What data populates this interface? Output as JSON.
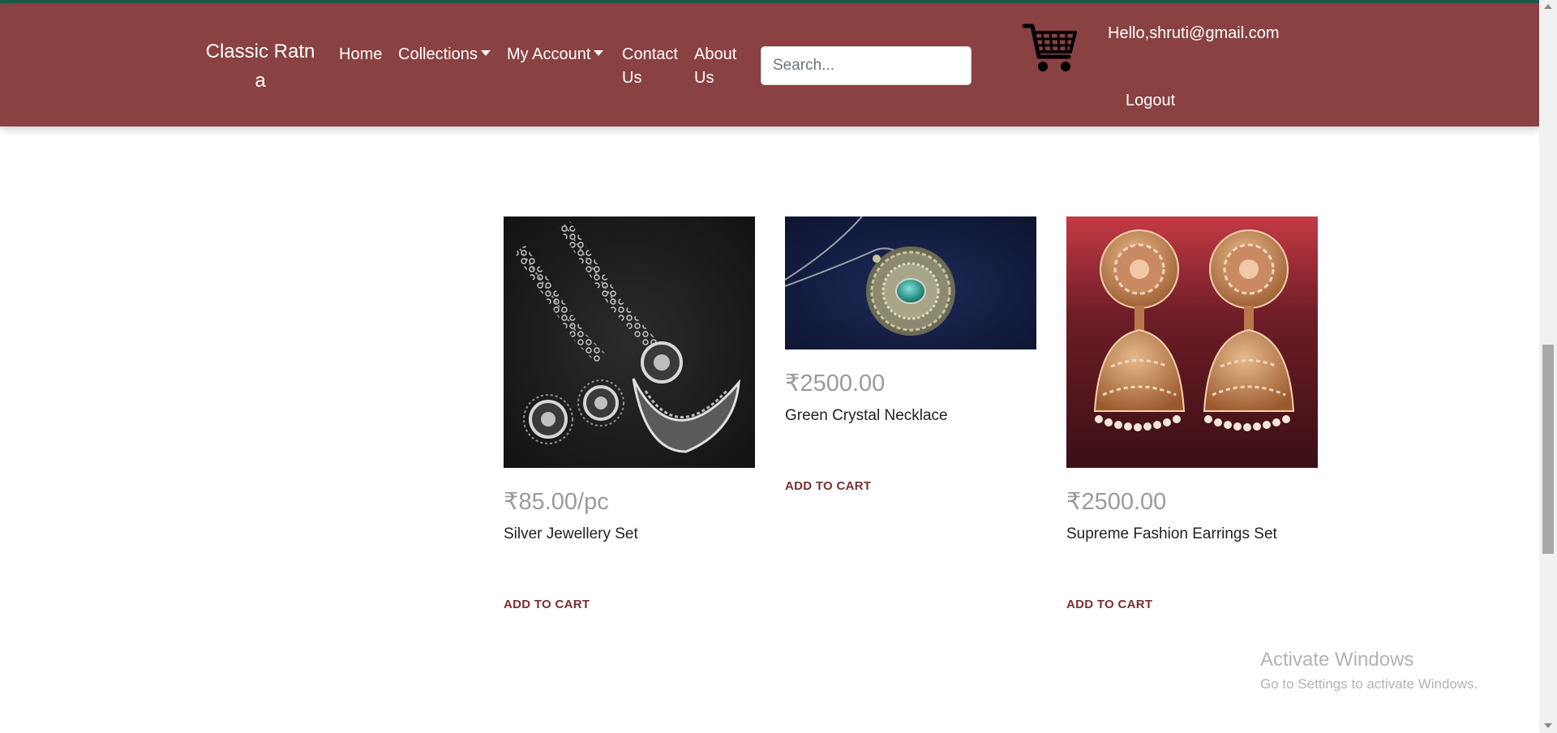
{
  "header": {
    "brand": "Classic Ratn a",
    "nav": {
      "home": "Home",
      "collections": "Collections",
      "my_account": "My Account",
      "contact_line1": "Contact",
      "contact_line2": "Us",
      "about_line1": "About",
      "about_line2": "Us"
    },
    "search_placeholder": "Search...",
    "cart_icon": "shopping-cart-icon",
    "greeting": "Hello,shruti@gmail.com",
    "logout": "Logout"
  },
  "products": [
    {
      "price": "₹85.00/pc",
      "name": "Silver Jewellery Set",
      "add_to_cart": "ADD TO CART"
    },
    {
      "price": "₹2500.00",
      "name": "Green Crystal Necklace",
      "add_to_cart": "ADD TO CART"
    },
    {
      "price": "₹2500.00",
      "name": "Supreme Fashion Earrings Set",
      "add_to_cart": "ADD TO CART"
    }
  ],
  "watermark": {
    "title": "Activate Windows",
    "subtitle": "Go to Settings to activate Windows."
  },
  "colors": {
    "navbar": "#8a4141",
    "top_accent": "#1f5a4a",
    "add_to_cart": "#7a2f2f",
    "price": "#9b9b9b"
  }
}
